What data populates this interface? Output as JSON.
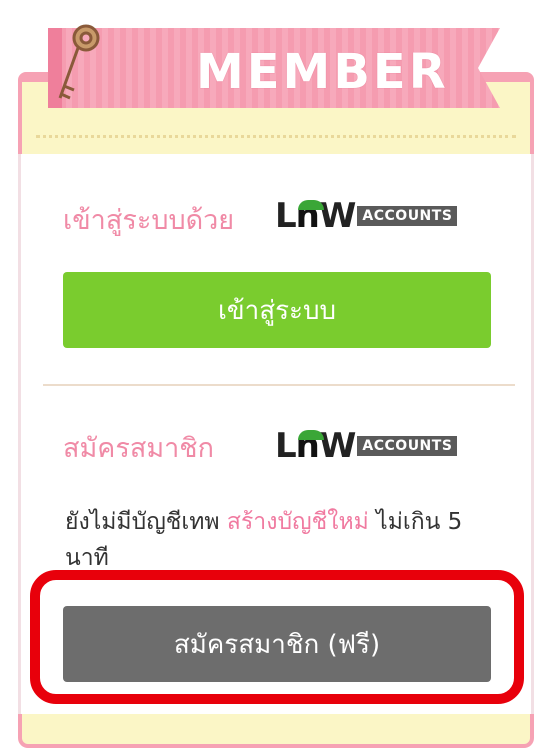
{
  "header": {
    "title": "MEMBER",
    "icon": "key-icon"
  },
  "login": {
    "heading": "เข้าสู่ระบบด้วย",
    "logo_text": "ACCOUNTS",
    "button_label": "เข้าสู่ระบบ"
  },
  "register": {
    "heading": "สมัครสมาชิก",
    "logo_text": "ACCOUNTS",
    "desc_prefix": "ยังไม่มีบัญชีเทพ",
    "desc_link": "สร้างบัญชีใหม่",
    "desc_suffix": "ไม่เกิน 5 นาที",
    "button_label": "สมัครสมาชิก (ฟรี)"
  },
  "colors": {
    "pink_accent": "#f08aa6",
    "login_button": "#7acc2e",
    "register_button": "#6d6d6d",
    "highlight": "#e8000b",
    "cream": "#fbf6c6"
  }
}
